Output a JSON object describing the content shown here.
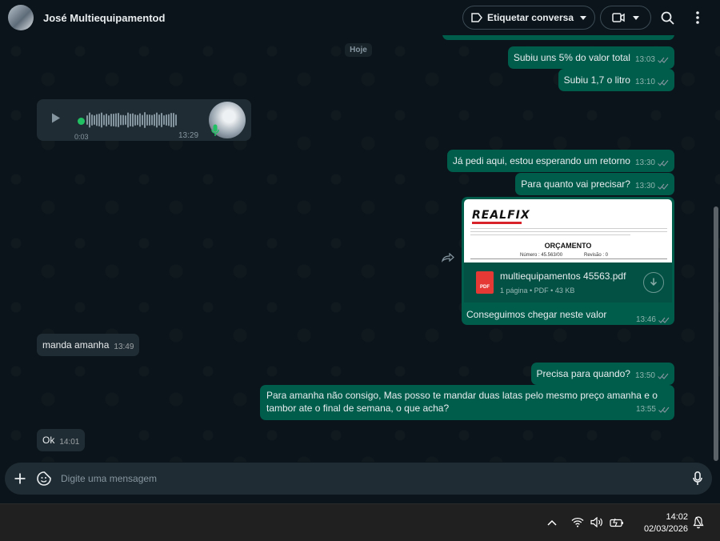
{
  "header": {
    "contact_name": "José Multiequipamentod",
    "label_button": "Etiquetar conversa"
  },
  "chat": {
    "day_label": "Hoje",
    "messages": [
      {
        "text": "Subiu uns 5% do valor total",
        "time": "13:03"
      },
      {
        "text": "Subiu 1,7 o litro",
        "time": "13:10"
      },
      {
        "text": "Já pedi aqui, estou esperando um retorno",
        "time": "13:30"
      },
      {
        "text": "Para quanto vai precisar?",
        "time": "13:30"
      },
      {
        "text": "manda amanha",
        "time": "13:49"
      },
      {
        "text": "Precisa para quando?",
        "time": "13:50"
      },
      {
        "text": "Para amanha não consigo, Mas posso te mandar duas latas pelo mesmo preço amanha e o tambor ate o final de semana, o que acha?",
        "time": "13:55"
      },
      {
        "text": "Ok",
        "time": "14:01"
      }
    ],
    "audio": {
      "current": "0:03",
      "time": "13:29",
      "progress": 0.02
    },
    "pdf": {
      "preview_logo": "REALFIX",
      "preview_title": "ORÇAMENTO",
      "preview_number": "Número : 45.563/00",
      "preview_revision": "Revisão : 0",
      "file_name": "multiequipamentos 45563.pdf",
      "file_meta": "1 página • PDF • 43 KB",
      "icon_label": "PDF",
      "caption": "Conseguimos chegar neste valor",
      "time": "13:46"
    }
  },
  "composer": {
    "placeholder": "Digite uma mensagem"
  },
  "taskbar": {
    "time": "14:02",
    "date": "02/03/2026"
  },
  "colors": {
    "outgoing": "#005c4b",
    "incoming": "#202c33",
    "background": "#0b141a",
    "accent": "#21c063",
    "ticks": "#8696a0"
  }
}
